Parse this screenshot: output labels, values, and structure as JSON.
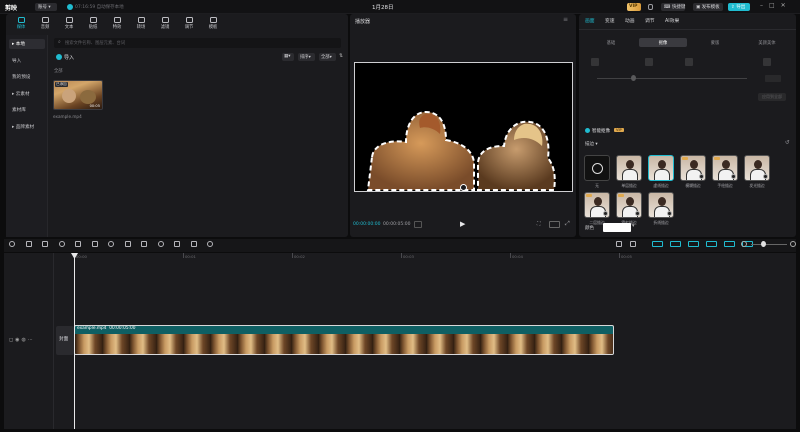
{
  "app": {
    "logo": "剪映",
    "draft_title": "1月28日",
    "account": "账号",
    "autosave": "07:16:59 自动保存本地"
  },
  "top_right": {
    "vip": "VIP",
    "shortcut": "快捷键",
    "beta": "体验",
    "publish": "发布模板",
    "export": "导出"
  },
  "toolbar_tabs": [
    {
      "label": "媒体",
      "icon": "media-icon"
    },
    {
      "label": "音频",
      "icon": "audio-icon"
    },
    {
      "label": "文本",
      "icon": "text-icon"
    },
    {
      "label": "贴纸",
      "icon": "sticker-icon"
    },
    {
      "label": "特效",
      "icon": "effects-icon"
    },
    {
      "label": "转场",
      "icon": "transition-icon"
    },
    {
      "label": "滤镜",
      "icon": "filter-icon"
    },
    {
      "label": "调节",
      "icon": "adjust-icon"
    },
    {
      "label": "模板",
      "icon": "template-icon"
    }
  ],
  "sidebar": [
    {
      "label": "▸ 本地",
      "active": true
    },
    {
      "label": "导入"
    },
    {
      "label": "我的预设"
    },
    {
      "label": "▸ 云素材"
    },
    {
      "label": "素材库"
    },
    {
      "label": "▸ 品牌素材"
    }
  ],
  "media": {
    "search_placeholder": "搜索文件名称、图层元素、台词",
    "import_label": "导入",
    "sort_label": "排序",
    "filter_label": "全部",
    "section_label": "全部",
    "clip": {
      "badge": "已添加",
      "duration": "00:05",
      "filename": "example.mp4"
    }
  },
  "player": {
    "title": "播放器",
    "time_current": "00:00:00:00",
    "time_total": "00:00:05:00"
  },
  "inspector": {
    "tabs": [
      "画面",
      "变速",
      "动画",
      "调节",
      "AI效果"
    ],
    "subtabs": [
      "基础",
      "抠像",
      "蒙版",
      "美颜美体"
    ],
    "apply_all": "应用到全部",
    "smart_cutout": "智能抠像",
    "vip_badge": "VIP",
    "stroke_header": "描边",
    "stroke_items": [
      "无",
      "单层描边",
      "虚线描边",
      "模糊描边",
      "手绘描边",
      "发光描边",
      "二层描边",
      "霓虹描边",
      "折线描边"
    ],
    "color_label": "颜色"
  },
  "timeline": {
    "ruler": [
      "00:00",
      "00:01",
      "00:02",
      "00:03",
      "00:04",
      "00:05"
    ],
    "track_cover": "封面",
    "clip_label": "example.mp4",
    "clip_duration": "00:00:05:00"
  }
}
